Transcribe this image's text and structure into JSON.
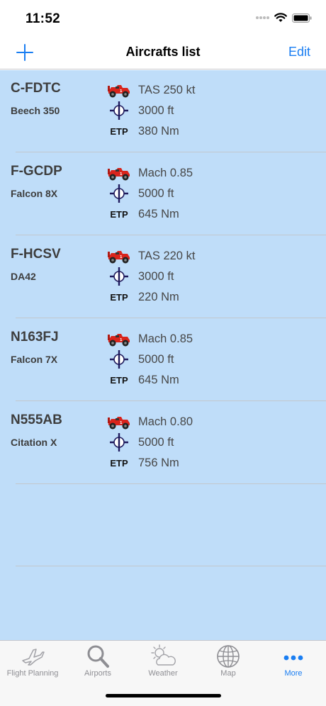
{
  "status": {
    "time": "11:52"
  },
  "nav": {
    "title": "Aircrafts list",
    "edit_label": "Edit",
    "add_icon": "plus-icon"
  },
  "aircraft": [
    {
      "registration": "C-FDTC",
      "model": "Beech 350",
      "speed": "TAS 250 kt",
      "altitude": "3000 ft",
      "etp_label": "ETP",
      "etp": "380 Nm"
    },
    {
      "registration": "F-GCDP",
      "model": "Falcon 8X",
      "speed": "Mach 0.85",
      "altitude": "5000 ft",
      "etp_label": "ETP",
      "etp": "645 Nm"
    },
    {
      "registration": "F-HCSV",
      "model": "DA42",
      "speed": "TAS 220 kt",
      "altitude": "3000 ft",
      "etp_label": "ETP",
      "etp": "220 Nm"
    },
    {
      "registration": "N163FJ",
      "model": "Falcon 7X",
      "speed": "Mach 0.85",
      "altitude": "5000 ft",
      "etp_label": "ETP",
      "etp": "645 Nm"
    },
    {
      "registration": "N555AB",
      "model": "Citation X",
      "speed": "Mach 0.80",
      "altitude": "5000 ft",
      "etp_label": "ETP",
      "etp": "756 Nm"
    }
  ],
  "tabs": [
    {
      "label": "Flight Planning",
      "icon": "airplane-icon",
      "active": false
    },
    {
      "label": "Airports",
      "icon": "magnifier-icon",
      "active": false
    },
    {
      "label": "Weather",
      "icon": "weather-icon",
      "active": false
    },
    {
      "label": "Map",
      "icon": "globe-icon",
      "active": false
    },
    {
      "label": "More",
      "icon": "more-icon",
      "active": true
    }
  ],
  "colors": {
    "accent": "#1a7ef2",
    "list_background": "#bfddf9",
    "racecar": "#d9241c"
  }
}
